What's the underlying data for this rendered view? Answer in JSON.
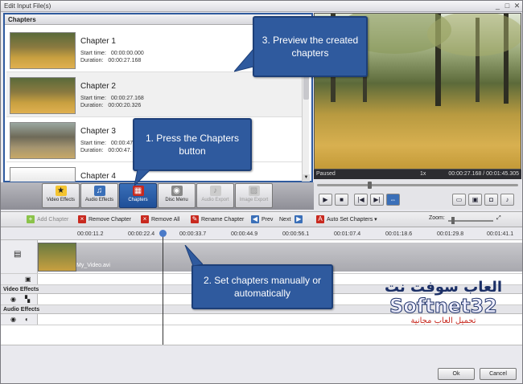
{
  "window": {
    "title": "Edit Input File(s)",
    "minimize": "_",
    "maximize": "□",
    "close": "✕"
  },
  "chapters_panel": {
    "header": "Chapters",
    "items": [
      {
        "name": "Chapter 1",
        "start_label": "Start time:",
        "start": "00:00:00.000",
        "duration_label": "Duration:",
        "duration": "00:00:27.168"
      },
      {
        "name": "Chapter 2",
        "start_label": "Start time:",
        "start": "00:00:27.168",
        "duration_label": "Duration:",
        "duration": "00:00:20.326"
      },
      {
        "name": "Chapter 3",
        "start_label": "Start time:",
        "start": "00:00:47.",
        "duration_label": "Duration:",
        "duration": "00:00:47."
      },
      {
        "name": "Chapter 4",
        "start_label": "",
        "start": "",
        "duration_label": "",
        "duration": ""
      }
    ]
  },
  "effects_toolbar": {
    "buttons": [
      {
        "label": "Video Effects",
        "icon": "video-effects-icon"
      },
      {
        "label": "Audio Effects",
        "icon": "audio-effects-icon"
      },
      {
        "label": "Chapters",
        "icon": "chapters-icon",
        "active": true
      },
      {
        "label": "Disc Menu",
        "icon": "disc-menu-icon"
      },
      {
        "label": "Audio Export",
        "icon": "audio-export-icon",
        "disabled": true
      },
      {
        "label": "Image Export",
        "icon": "image-export-icon",
        "disabled": true
      }
    ]
  },
  "player": {
    "state": "Paused",
    "zoom": "1x",
    "current_time": "00:00:27.168",
    "total_time": "00:01:45.305",
    "separator": "/",
    "position_fraction": 0.26
  },
  "chapter_toolbar": {
    "add": "Add Chapter",
    "remove": "Remove Chapter",
    "remove_all": "Remove All",
    "rename": "Rename Chapter",
    "prev": "Prev",
    "next": "Next",
    "auto_set": "Auto Set Chapters",
    "zoom_label": "Zoom:"
  },
  "ruler": {
    "ticks": [
      "00:00:11.2",
      "00:00:22.4",
      "00:00:33.7",
      "00:00:44.9",
      "00:00:56.1",
      "00:01:07.4",
      "00:01:18.6",
      "00:01:29.8",
      "00:01:41.1"
    ]
  },
  "timeline": {
    "clip_name": "My_Video.avi",
    "video_effects_label": "Video Effects",
    "audio_effects_label": "Audio Effects"
  },
  "footer": {
    "ok": "Ok",
    "cancel": "Cancel"
  },
  "callouts": {
    "preview": "3. Preview the created chapters",
    "press": "1. Press the Chapters button",
    "set": "2. Set chapters manually or automatically"
  },
  "watermark": {
    "arabic_top": "العاب سوفت نت",
    "brand": "Softnet32",
    "arabic_bottom": "تحميل العاب مجانية"
  },
  "colors": {
    "accent": "#2f5a9e",
    "callout_bg": "#2f5a9e",
    "active_tab": "#1f4f98"
  }
}
